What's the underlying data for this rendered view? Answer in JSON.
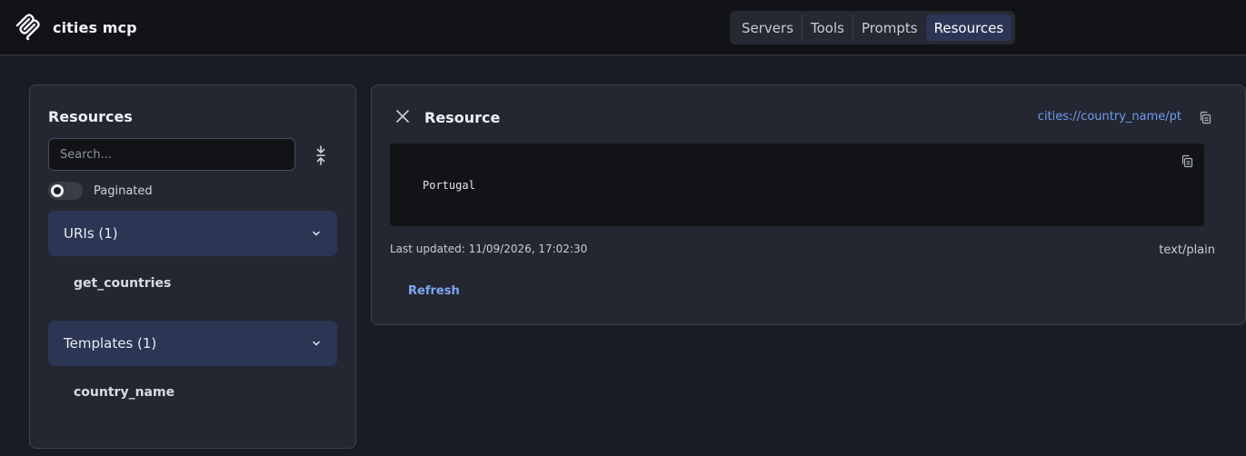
{
  "app": {
    "name": "cities mcp",
    "logo_icon": "mcp-logo-icon"
  },
  "nav": {
    "tabs": [
      {
        "label": "Servers",
        "active": false
      },
      {
        "label": "Tools",
        "active": false
      },
      {
        "label": "Prompts",
        "active": false
      },
      {
        "label": "Resources",
        "active": true
      }
    ]
  },
  "sidebar": {
    "title": "Resources",
    "search_placeholder": "Search...",
    "search_value": "",
    "collapse_icon": "collapse-vertical-icon",
    "paginated_label": "Paginated",
    "paginated_on": false,
    "sections": [
      {
        "label": "URIs (1)",
        "expanded": true,
        "items": [
          "get_countries"
        ]
      },
      {
        "label": "Templates (1)",
        "expanded": true,
        "items": [
          "country_name"
        ]
      }
    ]
  },
  "resource": {
    "title": "Resource",
    "uri": "cities://country_name/pt",
    "content": "Portugal",
    "last_updated": "Last updated: 11/09/2026, 17:02:30",
    "mime_type": "text/plain",
    "refresh_label": "Refresh"
  },
  "colors": {
    "background": "#1a1c23",
    "panel": "#242731",
    "accent": "#2b3554",
    "link": "#6f9cf0"
  }
}
